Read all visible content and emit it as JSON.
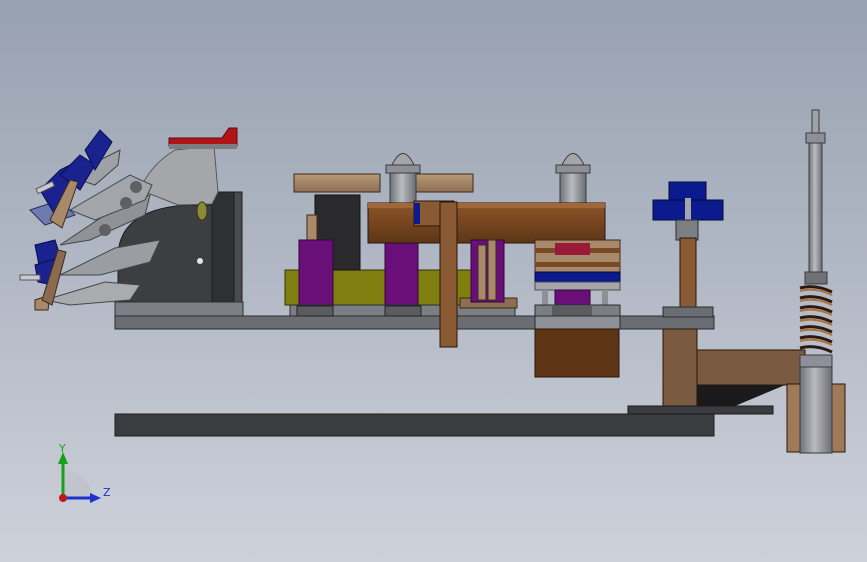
{
  "viewport": {
    "background_top": "#9aa3b2",
    "background_bottom": "#c9ced8"
  },
  "triad": {
    "y_label": "Y",
    "z_label": "Z",
    "y_color": "#19a019",
    "z_color": "#1f2fd0",
    "origin_color": "#c01818"
  },
  "colors": {
    "steel": "#6b6e72",
    "dark_plate": "#3c3d40",
    "brown": "#7a4a26",
    "dark_brown": "#5a3416",
    "tan": "#a88a6a",
    "purple": "#6a0f7a",
    "olive": "#7f7f10",
    "navy": "#0b1a8c",
    "red": "#b01418",
    "light_grey": "#a4a6aa",
    "grey": "#8d9096"
  }
}
